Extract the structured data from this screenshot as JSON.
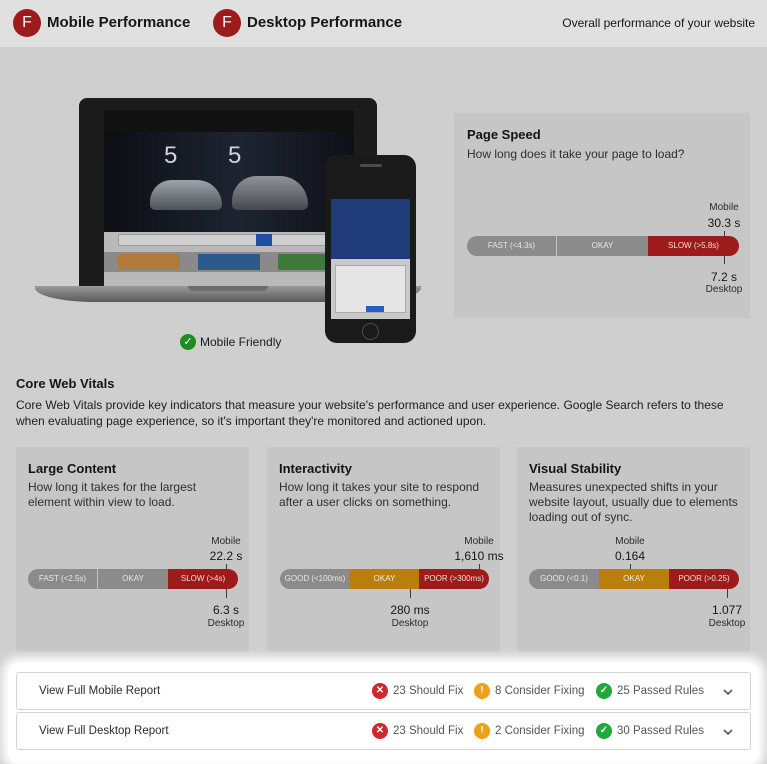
{
  "header": {
    "mobile": {
      "grade": "F",
      "title": "Mobile Performance"
    },
    "desktop": {
      "grade": "F",
      "title": "Desktop Performance"
    },
    "subtitle": "Overall performance of your website"
  },
  "device_preview": {
    "mobile_friendly_label": "Mobile Friendly",
    "check_icon": "check-circle-icon"
  },
  "page_speed": {
    "title": "Page Speed",
    "description": "How long does it take your page to load?",
    "segments": [
      "FAST (<4.3s)",
      "OKAY",
      "SLOW (>5.8s)"
    ],
    "mobile_value": "30.3 s",
    "mobile_label": "Mobile",
    "desktop_value": "7.2 s",
    "desktop_label": "Desktop"
  },
  "core_web_vitals": {
    "title": "Core Web Vitals",
    "description": "Core Web Vitals provide key indicators that measure your website's performance and user experience. Google Search refers to these when evaluating page experience, so it's important they're monitored and actioned upon.",
    "cards": [
      {
        "title": "Large Content",
        "description": "How long it takes for the largest element within view to load.",
        "segments": [
          "FAST (<2.5s)",
          "OKAY",
          "SLOW (>4s)"
        ],
        "mobile_label": "Mobile",
        "mobile_value": "22.2 s",
        "desktop_value": "6.3 s",
        "desktop_label": "Desktop"
      },
      {
        "title": "Interactivity",
        "description": "How long it takes your site to respond after a user clicks on something.",
        "segments": [
          "GOOD (<100ms)",
          "OKAY",
          "POOR (>300ms)"
        ],
        "mobile_label": "Mobile",
        "mobile_value": "1,610 ms",
        "desktop_value": "280 ms",
        "desktop_label": "Desktop"
      },
      {
        "title": "Visual Stability",
        "description": "Measures unexpected shifts in your website layout, usually due to elements loading out of sync.",
        "segments": [
          "GOOD (<0.1)",
          "OKAY",
          "POOR (>0.25)"
        ],
        "mobile_label": "Mobile",
        "mobile_value": "0.164",
        "desktop_value": "1.077",
        "desktop_label": "Desktop"
      }
    ]
  },
  "reports": [
    {
      "title": "View Full Mobile Report",
      "should_fix": "23 Should Fix",
      "consider_fixing": "8 Consider Fixing",
      "passed": "25 Passed Rules"
    },
    {
      "title": "View Full Desktop Report",
      "should_fix": "23 Should Fix",
      "consider_fixing": "2 Consider Fixing",
      "passed": "30 Passed Rules"
    }
  ],
  "colors": {
    "grade_fail": "#9e1b1b",
    "bar_red": "#9e1b1b",
    "bar_orange": "#b8800b",
    "bar_grey": "#8b8b8b",
    "status_red": "#d0272a",
    "status_orange": "#f0a012",
    "status_green": "#22a83a"
  }
}
